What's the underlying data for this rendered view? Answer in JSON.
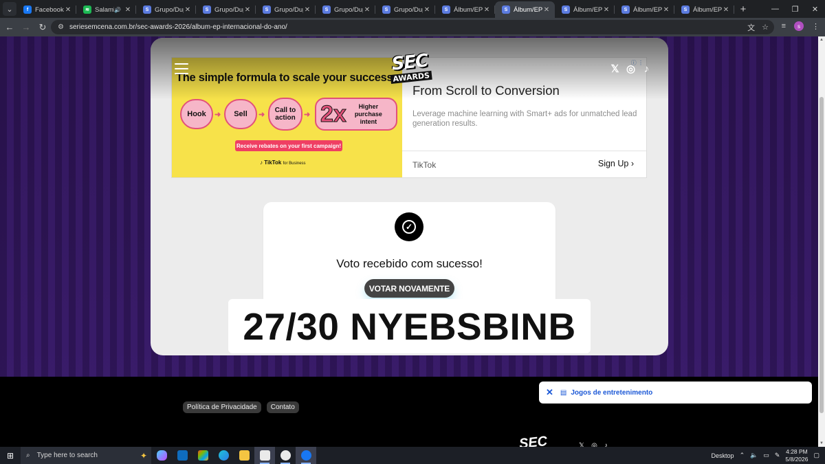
{
  "browser": {
    "tabs": [
      {
        "title": "Facebook",
        "icon": "facebook-icon",
        "color": "#1877f2",
        "active": false
      },
      {
        "title": "Salamin,",
        "icon": "spotify-icon",
        "color": "#1db954",
        "active": false,
        "audio": "🔊"
      },
      {
        "title": "Grupo/Dupl",
        "icon": "sec-icon",
        "color": "#5b7be0",
        "active": false
      },
      {
        "title": "Grupo/Dupl",
        "icon": "sec-icon",
        "color": "#5b7be0",
        "active": false
      },
      {
        "title": "Grupo/Dupl",
        "icon": "sec-icon",
        "color": "#5b7be0",
        "active": false
      },
      {
        "title": "Grupo/Dupl",
        "icon": "sec-icon",
        "color": "#5b7be0",
        "active": false
      },
      {
        "title": "Grupo/Dupl",
        "icon": "sec-icon",
        "color": "#5b7be0",
        "active": false
      },
      {
        "title": "Álbum/EP In",
        "icon": "sec-icon",
        "color": "#5b7be0",
        "active": false
      },
      {
        "title": "Álbum/EP In",
        "icon": "sec-icon",
        "color": "#5b7be0",
        "active": true
      },
      {
        "title": "Álbum/EP In",
        "icon": "sec-icon",
        "color": "#5b7be0",
        "active": false
      },
      {
        "title": "Álbum/EP In",
        "icon": "sec-icon",
        "color": "#5b7be0",
        "active": false
      },
      {
        "title": "Álbum/EP In",
        "icon": "sec-icon",
        "color": "#5b7be0",
        "active": false
      }
    ],
    "url": "seriesemcena.com.br/sec-awards-2026/album-ep-internacional-do-ano/"
  },
  "site": {
    "logo_top": "SEC",
    "logo_bottom": "AWARDS",
    "social": [
      "x-icon",
      "instagram-icon",
      "tiktok-icon"
    ]
  },
  "ad": {
    "image_headline": "The simple formula to scale your success",
    "steps": [
      "Hook",
      "Sell",
      "Call to action",
      "2x",
      "Higher purchase intent"
    ],
    "rebate": "Receive rebates on your first campaign!",
    "image_brand": "TikTok",
    "image_brand_suffix": "for Business",
    "title": "From Scroll to Conversion",
    "description": "Leverage machine learning with Smart+ ads for unmatched lead generation results.",
    "brand": "TikTok",
    "cta": "Sign Up"
  },
  "vote": {
    "message": "Voto recebido com sucesso!",
    "button": "VOTAR NOVAMENTE"
  },
  "caption": "27/30 NYEBSBINB",
  "footer": {
    "privacy": "Política de Privacidade",
    "contact": "Contato"
  },
  "toast": {
    "label": "Jogos de entretenimento"
  },
  "taskbar": {
    "search_placeholder": "Type here to search",
    "desktop_label": "Desktop",
    "time": "4:28 PM",
    "date": "5/8/2026"
  }
}
